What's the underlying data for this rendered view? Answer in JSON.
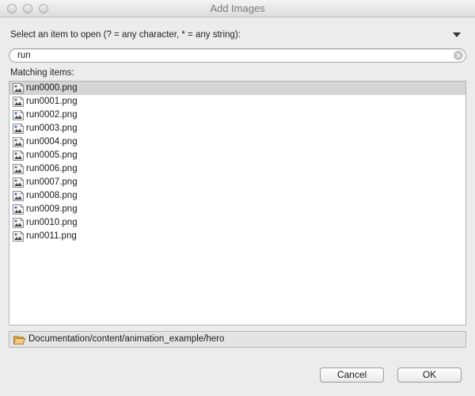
{
  "window": {
    "title": "Add Images"
  },
  "prompt": {
    "text": "Select an item to open (? = any character, * = any string):"
  },
  "search": {
    "value": "run",
    "placeholder": ""
  },
  "matching": {
    "label": "Matching items:",
    "selected_index": 0,
    "items": [
      {
        "name": "run0000.png",
        "icon": "image-file-icon"
      },
      {
        "name": "run0001.png",
        "icon": "image-file-icon"
      },
      {
        "name": "run0002.png",
        "icon": "image-file-icon"
      },
      {
        "name": "run0003.png",
        "icon": "image-file-icon"
      },
      {
        "name": "run0004.png",
        "icon": "image-file-icon"
      },
      {
        "name": "run0005.png",
        "icon": "image-file-icon"
      },
      {
        "name": "run0006.png",
        "icon": "image-file-icon"
      },
      {
        "name": "run0007.png",
        "icon": "image-file-icon"
      },
      {
        "name": "run0008.png",
        "icon": "image-file-icon"
      },
      {
        "name": "run0009.png",
        "icon": "image-file-icon"
      },
      {
        "name": "run0010.png",
        "icon": "image-file-icon"
      },
      {
        "name": "run0011.png",
        "icon": "image-file-icon"
      }
    ]
  },
  "location": {
    "path": "Documentation/content/animation_example/hero",
    "icon": "folder-open-icon"
  },
  "buttons": {
    "cancel": "Cancel",
    "ok": "OK"
  },
  "colors": {
    "selection": "#d5d5d5",
    "window_bg": "#ececec"
  }
}
